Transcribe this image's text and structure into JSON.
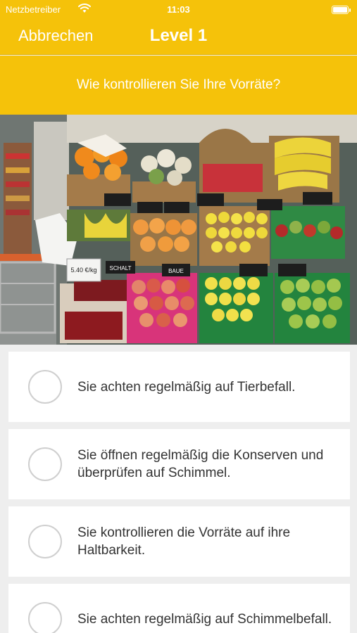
{
  "status_bar": {
    "carrier": "Netzbetreiber",
    "time": "11:03"
  },
  "nav": {
    "cancel_label": "Abbrechen",
    "title": "Level 1"
  },
  "question": "Wie kontrollieren Sie Ihre Vorräte?",
  "photo": {
    "description_icon": "market-produce-photo",
    "signs": [
      "5.40 €/kg",
      "SCHALT",
      "BAUE"
    ]
  },
  "answers": [
    {
      "text": "Sie achten regelmäßig auf Tierbefall."
    },
    {
      "text": "Sie öffnen regelmäßig die Konserven und überprüfen auf Schimmel."
    },
    {
      "text": "Sie kontrollieren die Vorräte auf ihre Haltbarkeit."
    },
    {
      "text": "Sie achten regelmäßig auf Schimmelbefall."
    }
  ],
  "colors": {
    "accent": "#f5c20a",
    "background": "#eeeeee"
  }
}
